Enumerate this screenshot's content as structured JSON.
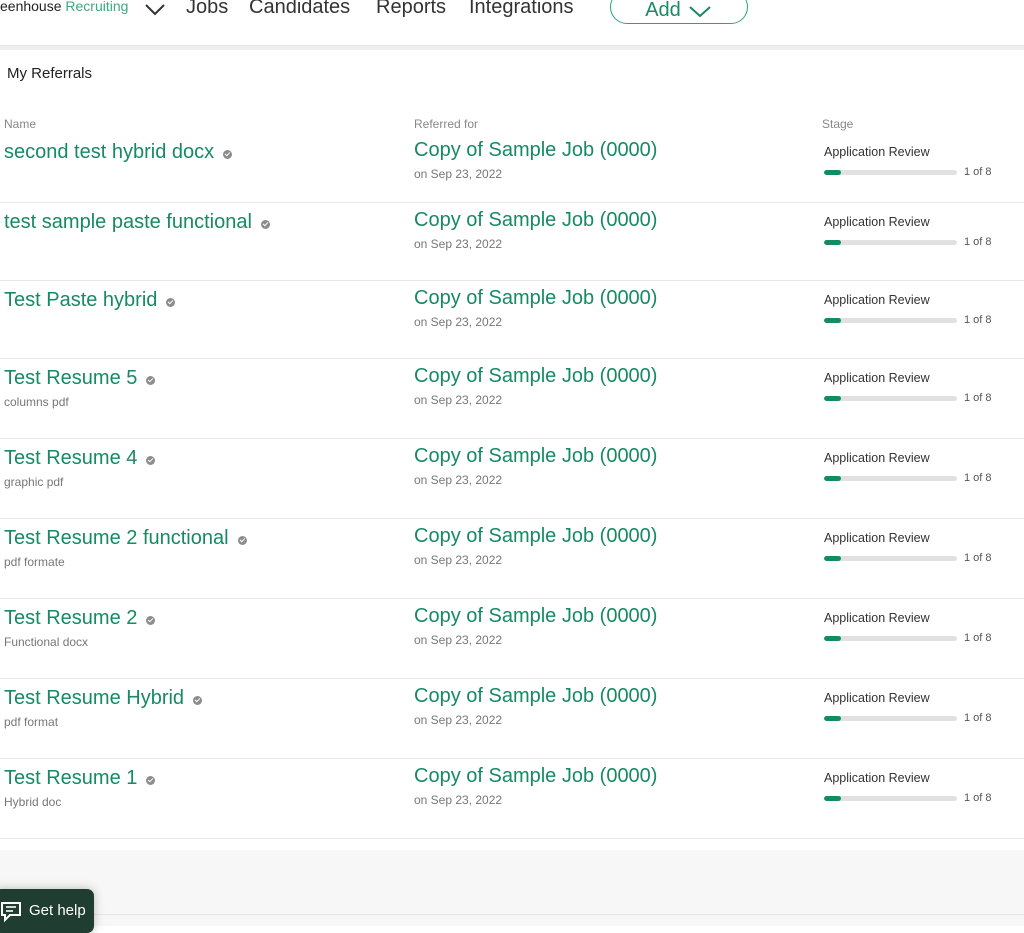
{
  "nav": {
    "brand_prefix": "eenhouse",
    "brand_suffix": "Recruiting",
    "links": [
      "Jobs",
      "Candidates",
      "Reports",
      "Integrations"
    ],
    "add_label": "Add"
  },
  "panel": {
    "title": "My Referrals",
    "headers": {
      "name": "Name",
      "referred_for": "Referred for",
      "stage": "Stage"
    }
  },
  "referrals": [
    {
      "name": "second test hybrid docx",
      "note": "",
      "job": "Copy of Sample Job (0000)",
      "date": "on Sep 23, 2022",
      "stage": "Application Review",
      "step": 1,
      "total": 8,
      "progress_label": "1 of 8"
    },
    {
      "name": "test sample paste functional",
      "note": "",
      "job": "Copy of Sample Job (0000)",
      "date": "on Sep 23, 2022",
      "stage": "Application Review",
      "step": 1,
      "total": 8,
      "progress_label": "1 of 8"
    },
    {
      "name": "Test Paste hybrid",
      "note": "",
      "job": "Copy of Sample Job (0000)",
      "date": "on Sep 23, 2022",
      "stage": "Application Review",
      "step": 1,
      "total": 8,
      "progress_label": "1 of 8"
    },
    {
      "name": "Test Resume 5",
      "note": "columns pdf",
      "job": "Copy of Sample Job (0000)",
      "date": "on Sep 23, 2022",
      "stage": "Application Review",
      "step": 1,
      "total": 8,
      "progress_label": "1 of 8"
    },
    {
      "name": "Test Resume 4",
      "note": "graphic pdf",
      "job": "Copy of Sample Job (0000)",
      "date": "on Sep 23, 2022",
      "stage": "Application Review",
      "step": 1,
      "total": 8,
      "progress_label": "1 of 8"
    },
    {
      "name": "Test Resume 2 functional",
      "note": "pdf formate",
      "job": "Copy of Sample Job (0000)",
      "date": "on Sep 23, 2022",
      "stage": "Application Review",
      "step": 1,
      "total": 8,
      "progress_label": "1 of 8"
    },
    {
      "name": "Test Resume 2",
      "note": "Functional docx",
      "job": "Copy of Sample Job (0000)",
      "date": "on Sep 23, 2022",
      "stage": "Application Review",
      "step": 1,
      "total": 8,
      "progress_label": "1 of 8"
    },
    {
      "name": "Test Resume Hybrid",
      "note": "pdf format",
      "job": "Copy of Sample Job (0000)",
      "date": "on Sep 23, 2022",
      "stage": "Application Review",
      "step": 1,
      "total": 8,
      "progress_label": "1 of 8"
    },
    {
      "name": "Test Resume 1",
      "note": "Hybrid doc",
      "job": "Copy of Sample Job (0000)",
      "date": "on Sep 23, 2022",
      "stage": "Application Review",
      "step": 1,
      "total": 8,
      "progress_label": "1 of 8"
    }
  ],
  "help": {
    "label": "Get help"
  }
}
